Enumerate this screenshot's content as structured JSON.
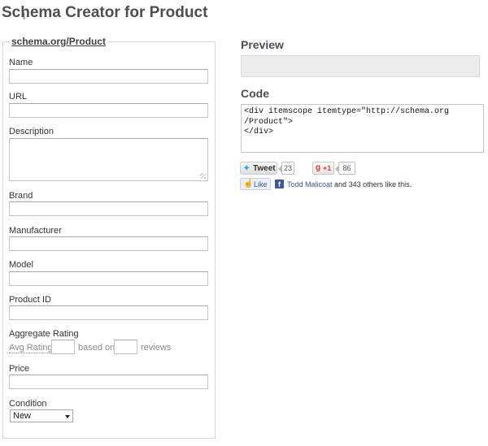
{
  "page": {
    "title": "Schema Creator for Product"
  },
  "form": {
    "legend": "schema.org/Product",
    "fields": {
      "name": "Name",
      "url": "URL",
      "description": "Description",
      "brand": "Brand",
      "manufacturer": "Manufacturer",
      "model": "Model",
      "product_id": "Product ID",
      "aggregate_rating": "Aggregate Rating",
      "price": "Price",
      "condition": "Condition"
    },
    "rating": {
      "avg": "Avg Rating",
      "based_on": "based on",
      "reviews": "reviews"
    },
    "condition_selected": "New"
  },
  "preview": {
    "heading": "Preview"
  },
  "code": {
    "heading": "Code",
    "value": "<div itemscope itemtype=\"http://schema.org\n/Product\">\n</div>"
  },
  "social": {
    "tweet_label": "Tweet",
    "tweet_count": "23",
    "gplus_label": "+1",
    "gplus_count": "86",
    "like_label": "Like",
    "fb_name": "Todd Malicoat",
    "fb_rest": "and 343 others like this."
  },
  "icons": {
    "cursor": "text-cursor-icon",
    "twitter": "twitter-bird-icon",
    "gplus": "google-plus-icon",
    "like": "thumbs-up-icon",
    "facebook": "facebook-icon"
  },
  "colors": {
    "title": "#4a4f55",
    "facebook": "#3b5998",
    "twitter": "#2aa3ef",
    "gplus": "#d73d32"
  }
}
